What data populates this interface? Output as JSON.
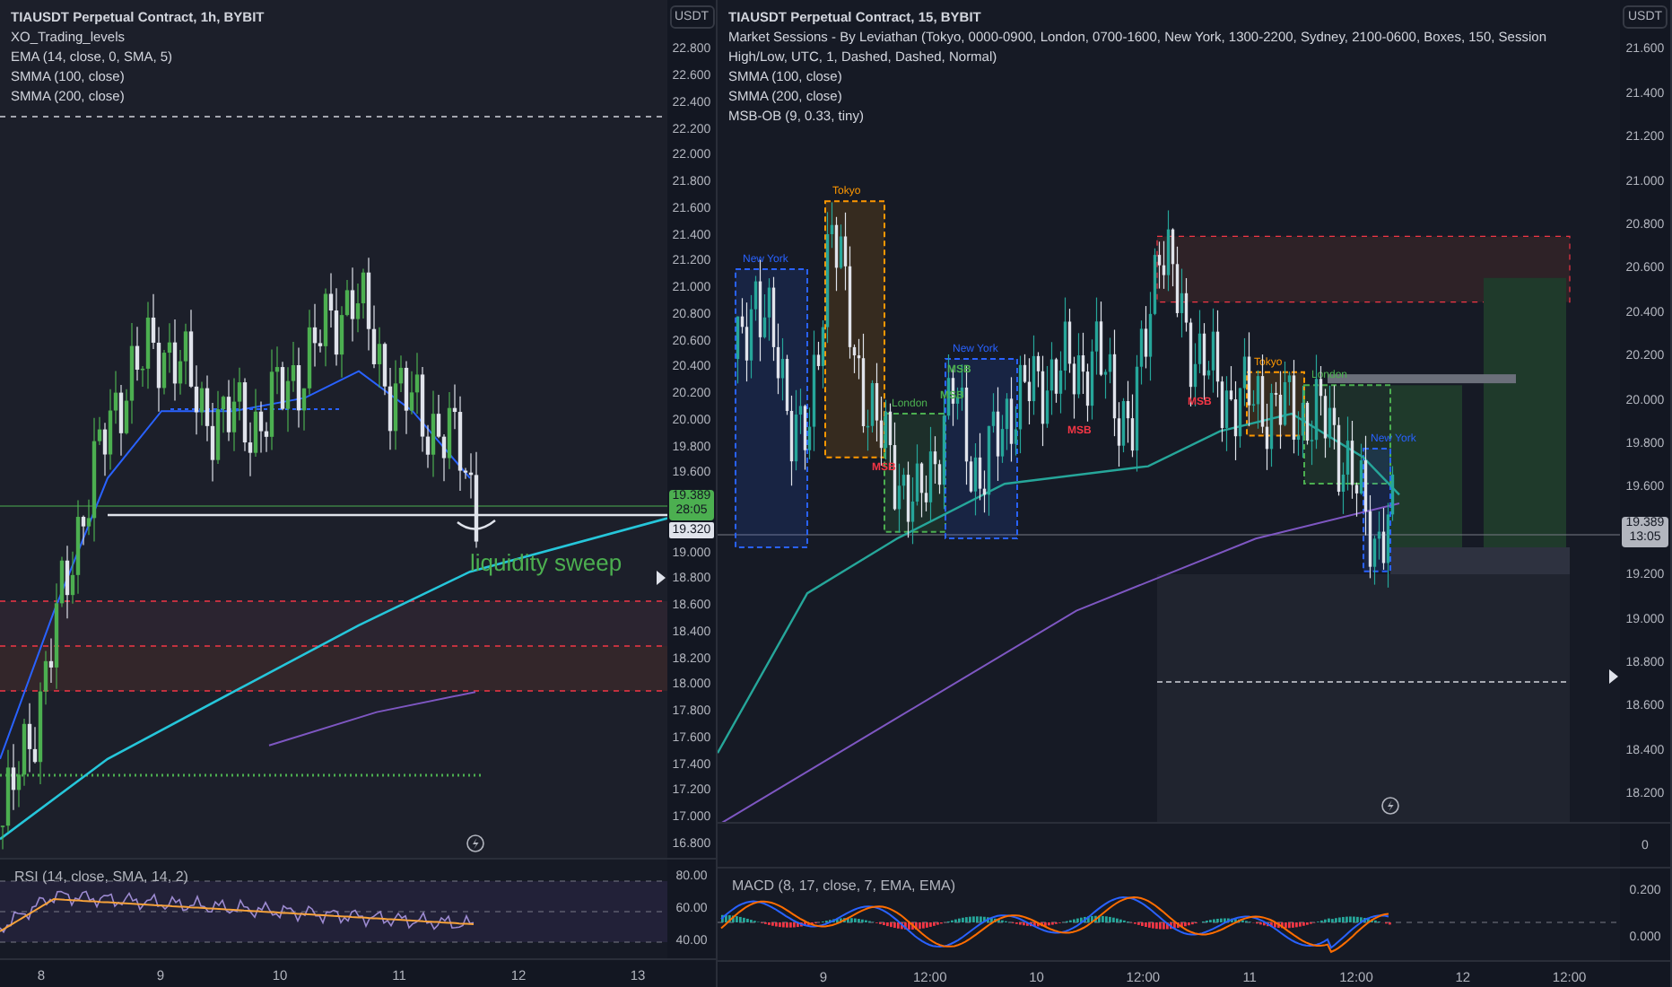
{
  "panels": [
    {
      "legend": {
        "title": "TIAUSDT Perpetual Contract, 1h, BYBIT",
        "indicators": [
          "XO_Trading_levels",
          "EMA (14, close, 0, SMA, 5)",
          "SMMA (100, close)",
          "SMMA (200, close)"
        ]
      },
      "currency": "USDT",
      "price_axis_upper": [
        "22.800",
        "22.600",
        "22.400",
        "22.200",
        "22.000",
        "21.800",
        "21.600",
        "21.400",
        "21.200",
        "21.000",
        "20.800",
        "20.600",
        "20.400",
        "20.200",
        "20.000",
        "19.800",
        "19.600"
      ],
      "price_tag": {
        "price": "19.389",
        "countdown": "28:05",
        "color": "#4caf50"
      },
      "level_tag": "19.320",
      "price_axis_lower": [
        "19.000",
        "18.800",
        "18.600",
        "18.400",
        "18.200",
        "18.000",
        "17.800",
        "17.600",
        "17.400",
        "17.200",
        "17.000",
        "16.800"
      ],
      "annotation": "liquidity sweep",
      "panes": [
        {
          "kind": "rsi",
          "title": "RSI (14, close, SMA, 14, 2)",
          "axis": [
            "80.00",
            "60.00",
            "40.00"
          ]
        }
      ],
      "time_axis": [
        "8",
        "9",
        "10",
        "11",
        "12",
        "13"
      ]
    },
    {
      "legend": {
        "title": "TIAUSDT Perpetual Contract, 15, BYBIT",
        "indicators": [
          "Market Sessions - By Leviathan (Tokyo, 0000-0900, London, 0700-1600, New York, 1300-2200, Sydney, 2100-0600, Boxes, 150, Session High/Low, UTC, 1, Dashed, Dashed, Normal)",
          "SMMA (100, close)",
          "SMMA (200, close)",
          "MSB-OB (9, 0.33, tiny)"
        ]
      },
      "currency": "USDT",
      "price_axis_upper": [
        "21.600",
        "21.400",
        "21.200",
        "21.000",
        "20.800",
        "20.600",
        "20.400",
        "20.200",
        "20.000",
        "19.800",
        "19.600"
      ],
      "price_tag": {
        "price": "19.389",
        "countdown": "13:05",
        "color": "#b2b5be"
      },
      "price_axis_lower": [
        "19.200",
        "19.000",
        "18.800",
        "18.600",
        "18.400",
        "18.200"
      ],
      "sessions": [
        {
          "label": "New York",
          "color": "#2962ff"
        },
        {
          "label": "Tokyo",
          "color": "#ff9800"
        },
        {
          "label": "London",
          "color": "#4caf50"
        },
        {
          "label": "New York",
          "color": "#2962ff"
        },
        {
          "label": "Tokyo",
          "color": "#ff9800"
        },
        {
          "label": "London",
          "color": "#4caf50"
        },
        {
          "label": "New York",
          "color": "#2962ff"
        }
      ],
      "markers": [
        {
          "text": "MSB",
          "color": "#4caf50"
        },
        {
          "text": "MSB",
          "color": "#4caf50"
        },
        {
          "text": "MSB",
          "color": "#f23645"
        },
        {
          "text": "MSB",
          "color": "#f23645"
        },
        {
          "text": "MSB",
          "color": "#f23645"
        }
      ],
      "panes": [
        {
          "kind": "volume",
          "axis": [
            "0"
          ]
        },
        {
          "kind": "macd",
          "title": "MACD (8, 17, close, 7, EMA, EMA)",
          "axis": [
            "0.200",
            "0.000"
          ]
        }
      ],
      "time_axis": [
        "9",
        "12:00",
        "10",
        "12:00",
        "11",
        "12:00",
        "12",
        "12:00"
      ]
    }
  ]
}
